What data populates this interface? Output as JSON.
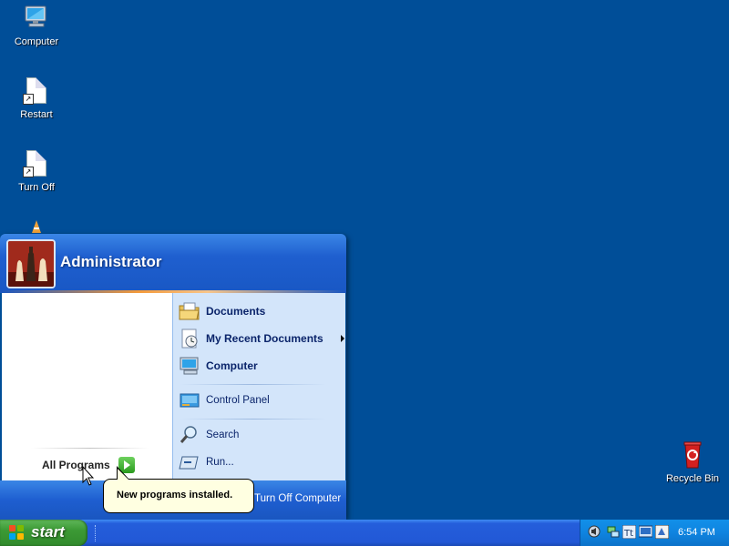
{
  "desktop": {
    "icons": [
      {
        "label": "Computer",
        "icon": "computer-icon"
      },
      {
        "label": "Restart",
        "icon": "restart-shortcut-icon"
      },
      {
        "label": "Turn Off",
        "icon": "turn-off-shortcut-icon"
      },
      {
        "label": "Recycle Bin",
        "icon": "recycle-bin-icon"
      }
    ]
  },
  "start_menu": {
    "user_name": "Administrator",
    "all_programs": "All Programs",
    "right_items": [
      {
        "label": "Documents",
        "icon": "documents-folder-icon"
      },
      {
        "label": "My Recent Documents",
        "icon": "recent-documents-icon"
      },
      {
        "label": "Computer",
        "icon": "computer-icon"
      },
      {
        "label": "Control Panel",
        "icon": "control-panel-icon"
      },
      {
        "label": "Search",
        "icon": "search-icon"
      },
      {
        "label": "Run...",
        "icon": "run-icon"
      }
    ],
    "turn_off": "Turn Off Computer"
  },
  "balloon": {
    "text": "New programs installed."
  },
  "taskbar": {
    "start_label": "start",
    "clock": "6:54 PM"
  },
  "colors": {
    "desktop": "#004e98",
    "start_green": "#3c9a35",
    "menu_blue": "#1f5fcf"
  }
}
